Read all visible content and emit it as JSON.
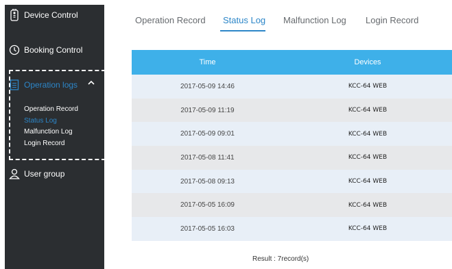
{
  "sidebar": {
    "device_control": "Device Control",
    "booking_control": "Booking Control",
    "operation_logs": "Operation logs",
    "user_group": "User group",
    "sub_items": [
      "Operation Record",
      "Status Log",
      "Malfunction Log",
      "Login Record"
    ],
    "active_sub_item": "Status Log"
  },
  "tabs": {
    "items": [
      "Operation Record",
      "Status Log",
      "Malfunction Log",
      "Login Record"
    ],
    "active": "Status Log"
  },
  "table": {
    "headers": [
      "Time",
      "Devices"
    ],
    "rows": [
      [
        "2017-05-09 14:46",
        "KCC-64 WEB"
      ],
      [
        "2017-05-09 11:19",
        "KCC-64 WEB"
      ],
      [
        "2017-05-09 09:01",
        "KCC-64 WEB"
      ],
      [
        "2017-05-08 11:41",
        "KCC-64 WEB"
      ],
      [
        "2017-05-08 09:13",
        "KCC-64 WEB"
      ],
      [
        "2017-05-05 16:09",
        "KCC-64 WEB"
      ],
      [
        "2017-05-05 16:03",
        "KCC-64 WEB"
      ]
    ]
  },
  "result_text": "Result : 7record(s)",
  "colors": {
    "sidebar_bg": "#2b2e31",
    "accent": "#2c86c8",
    "header_bg": "#3eb0e9",
    "row_odd": "#e8eff7",
    "row_even": "#e7e8ea"
  },
  "icons": {
    "device_control": "remote-icon",
    "booking_control": "clock-icon",
    "operation_logs": "document-icon",
    "user_group": "user-icon",
    "expand": "chevron-up-icon"
  }
}
